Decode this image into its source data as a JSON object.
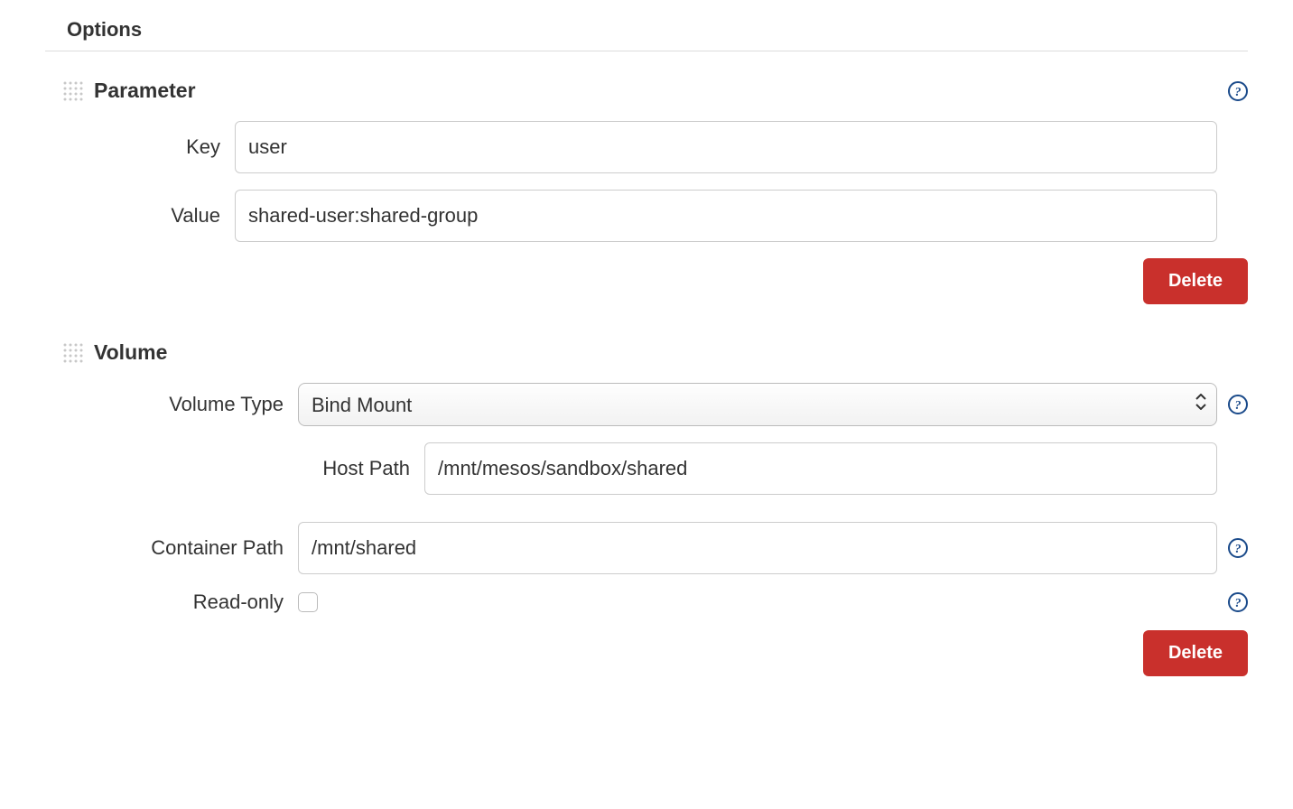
{
  "section_title": "Options",
  "parameter": {
    "title": "Parameter",
    "key_label": "Key",
    "key_value": "user",
    "value_label": "Value",
    "value_value": "shared-user:shared-group",
    "delete_label": "Delete"
  },
  "volume": {
    "title": "Volume",
    "type_label": "Volume Type",
    "type_value": "Bind Mount",
    "host_path_label": "Host Path",
    "host_path_value": "/mnt/mesos/sandbox/shared",
    "container_path_label": "Container Path",
    "container_path_value": "/mnt/shared",
    "readonly_label": "Read-only",
    "readonly_checked": false,
    "delete_label": "Delete"
  }
}
